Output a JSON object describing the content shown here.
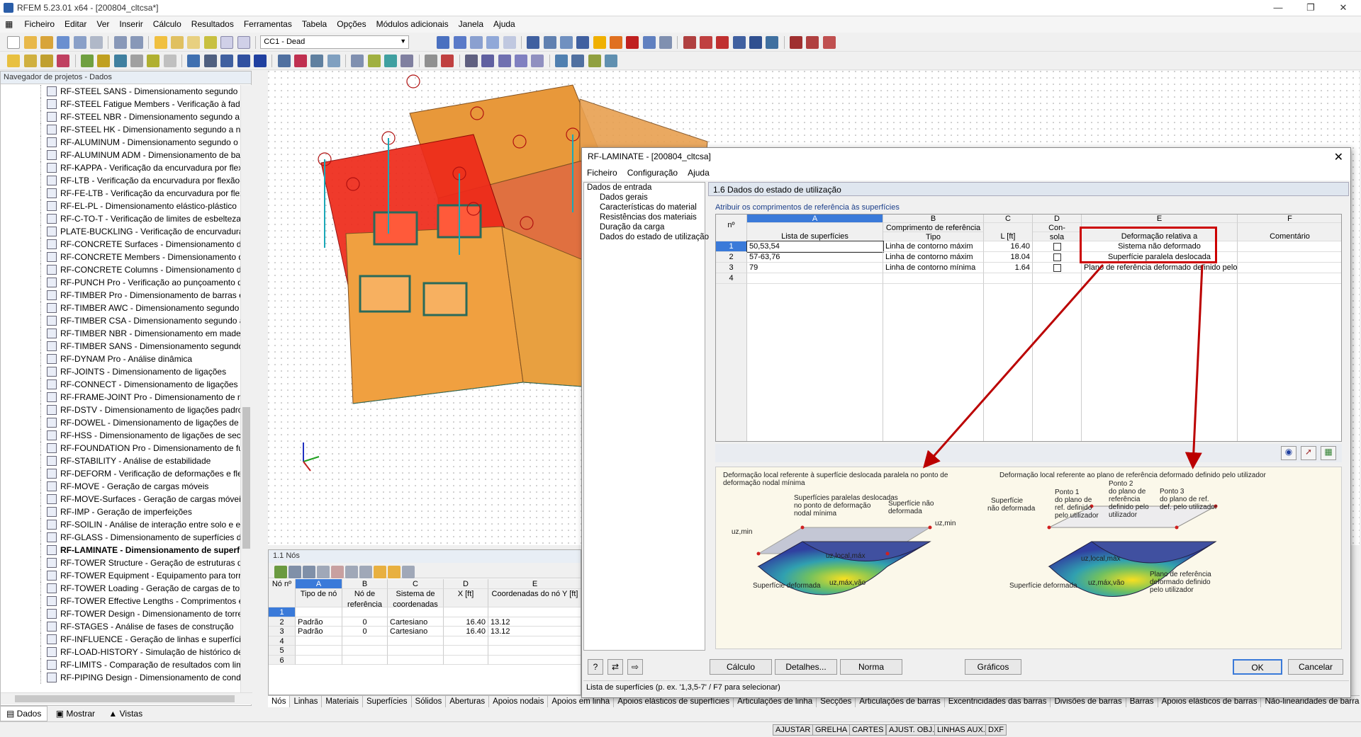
{
  "window": {
    "title": "RFEM 5.23.01 x64 - [200804_cltcsa*]"
  },
  "menu": [
    "Ficheiro",
    "Editar",
    "Ver",
    "Inserir",
    "Cálculo",
    "Resultados",
    "Ferramentas",
    "Tabela",
    "Opções",
    "Módulos adicionais",
    "Janela",
    "Ajuda"
  ],
  "toolbar": {
    "loadcase": "CC1 - Dead"
  },
  "navigator": {
    "title": "Navegador de projetos - Dados",
    "items": [
      {
        "label": "RF-STEEL SANS - Dimensionamento segundo a nor",
        "bold": false
      },
      {
        "label": "RF-STEEL Fatigue Members - Verificação à fadiga",
        "bold": false
      },
      {
        "label": "RF-STEEL NBR - Dimensionamento segundo a NBR",
        "bold": false
      },
      {
        "label": "RF-STEEL HK - Dimensionamento segundo a norm",
        "bold": false
      },
      {
        "label": "RF-ALUMINUM - Dimensionamento segundo o Eu",
        "bold": false
      },
      {
        "label": "RF-ALUMINUM ADM - Dimensionamento de barra",
        "bold": false
      },
      {
        "label": "RF-KAPPA - Verificação da encurvadura por flexão",
        "bold": false
      },
      {
        "label": "RF-LTB - Verificação da encurvadura por flexão-tor",
        "bold": false
      },
      {
        "label": "RF-FE-LTB - Verificação da encurvadura por flexão",
        "bold": false
      },
      {
        "label": "RF-EL-PL - Dimensionamento elástico-plástico",
        "bold": false
      },
      {
        "label": "RF-C-TO-T - Verificação de limites de esbelteza (c/t",
        "bold": false
      },
      {
        "label": "PLATE-BUCKLING - Verificação de encurvadura loc",
        "bold": false
      },
      {
        "label": "RF-CONCRETE Surfaces - Dimensionamento de sup",
        "bold": false
      },
      {
        "label": "RF-CONCRETE Members - Dimensionamento de ba",
        "bold": false
      },
      {
        "label": "RF-CONCRETE Columns - Dimensionamento de pi",
        "bold": false
      },
      {
        "label": "RF-PUNCH Pro - Verificação ao punçoamento de s",
        "bold": false
      },
      {
        "label": "RF-TIMBER Pro - Dimensionamento de barras em r",
        "bold": false
      },
      {
        "label": "RF-TIMBER AWC - Dimensionamento segundo a n",
        "bold": false
      },
      {
        "label": "RF-TIMBER CSA - Dimensionamento segundo a no",
        "bold": false
      },
      {
        "label": "RF-TIMBER NBR - Dimensionamento em madeira s",
        "bold": false
      },
      {
        "label": "RF-TIMBER SANS - Dimensionamento segundo a n",
        "bold": false
      },
      {
        "label": "RF-DYNAM Pro - Análise dinâmica",
        "bold": false
      },
      {
        "label": "RF-JOINTS - Dimensionamento de ligações",
        "bold": false
      },
      {
        "label": "RF-CONNECT - Dimensionamento de ligações de c",
        "bold": false
      },
      {
        "label": "RF-FRAME-JOINT Pro - Dimensionamento de nós c",
        "bold": false
      },
      {
        "label": "RF-DSTV - Dimensionamento de ligações padroniz",
        "bold": false
      },
      {
        "label": "RF-DOWEL - Dimensionamento de ligações de cav",
        "bold": false
      },
      {
        "label": "RF-HSS - Dimensionamento de ligações de secção",
        "bold": false
      },
      {
        "label": "RF-FOUNDATION Pro - Dimensionamento de fund",
        "bold": false
      },
      {
        "label": "RF-STABILITY - Análise de estabilidade",
        "bold": false
      },
      {
        "label": "RF-DEFORM - Verificação de deformações e flecha",
        "bold": false
      },
      {
        "label": "RF-MOVE - Geração de cargas móveis",
        "bold": false
      },
      {
        "label": "RF-MOVE-Surfaces - Geração de cargas móveis em",
        "bold": false
      },
      {
        "label": "RF-IMP - Geração de imperfeições",
        "bold": false
      },
      {
        "label": "RF-SOILIN - Análise de interação entre solo e estrut",
        "bold": false
      },
      {
        "label": "RF-GLASS - Dimensionamento de superfícies de vic",
        "bold": false
      },
      {
        "label": "RF-LAMINATE - Dimensionamento de superfície",
        "bold": true
      },
      {
        "label": "RF-TOWER Structure - Geração de estruturas de tor",
        "bold": false
      },
      {
        "label": "RF-TOWER Equipment - Equipamento para torres t",
        "bold": false
      },
      {
        "label": "RF-TOWER Loading - Geração de cargas de torres t",
        "bold": false
      },
      {
        "label": "RF-TOWER Effective Lengths - Comprimentos efeti",
        "bold": false
      },
      {
        "label": "RF-TOWER Design - Dimensionamento de torres tri",
        "bold": false
      },
      {
        "label": "RF-STAGES - Análise de fases de construção",
        "bold": false
      },
      {
        "label": "RF-INFLUENCE - Geração de linhas e superfícies de",
        "bold": false
      },
      {
        "label": "RF-LOAD-HISTORY - Simulação de histórico de car",
        "bold": false
      },
      {
        "label": "RF-LIMITS - Comparação de resultados com limites",
        "bold": false
      },
      {
        "label": "RF-PIPING Design - Dimensionamento de conduta",
        "bold": false
      }
    ],
    "tabs": [
      "Dados",
      "Mostrar",
      "Vistas"
    ]
  },
  "nodes_panel": {
    "title": "1.1 Nós",
    "cols": [
      "A",
      "B",
      "C",
      "D",
      "E"
    ],
    "headers": [
      "Nó nº",
      "Tipo de nó",
      "Nó de referência",
      "Sistema de coordenadas",
      "X [ft]",
      "Coordenadas do nó Y [ft]"
    ],
    "rows": [
      {
        "n": "1",
        "tipo": "",
        "ref": "",
        "sis": "",
        "x": "",
        "y": ""
      },
      {
        "n": "2",
        "tipo": "Padrão",
        "ref": "0",
        "sis": "Cartesiano",
        "x": "16.40",
        "y": "13.12"
      },
      {
        "n": "3",
        "tipo": "Padrão",
        "ref": "0",
        "sis": "Cartesiano",
        "x": "16.40",
        "y": "13.12"
      },
      {
        "n": "4",
        "tipo": "",
        "ref": "",
        "sis": "",
        "x": "",
        "y": ""
      },
      {
        "n": "5",
        "tipo": "",
        "ref": "",
        "sis": "",
        "x": "",
        "y": ""
      },
      {
        "n": "6",
        "tipo": "",
        "ref": "",
        "sis": "",
        "x": "",
        "y": ""
      }
    ]
  },
  "bottom_tabs": [
    "Nós",
    "Linhas",
    "Materiais",
    "Superfícies",
    "Sólidos",
    "Aberturas",
    "Apoios nodais",
    "Apoios em linha",
    "Apoios elásticos de superfícies",
    "Articulações de linha",
    "Secções",
    "Articulações de barras",
    "Excentricidades das barras",
    "Divisões de barras",
    "Barras",
    "Apoios elásticos de barras",
    "Não-linearidades de barras"
  ],
  "status": [
    "AJUSTAR",
    "GRELHA",
    "CARTES",
    "AJUST. OBJ.",
    "LINHAS AUX.",
    "DXF"
  ],
  "dialog": {
    "title": "RF-LAMINATE - [200804_cltcsa]",
    "menu": [
      "Ficheiro",
      "Configuração",
      "Ajuda"
    ],
    "tree": {
      "root": "Dados de entrada",
      "children": [
        "Dados gerais",
        "Características do material",
        "Resistências dos materiais",
        "Duração da carga",
        "Dados do estado de utilização"
      ]
    },
    "page_title": "1.6 Dados do estado de utilização",
    "subtitle": "Atribuir os comprimentos de referência às superfícies",
    "grid": {
      "cols": [
        "A",
        "B",
        "C",
        "D",
        "E",
        "F"
      ],
      "h_no": "nº",
      "h_a": "Lista de superfícies",
      "h_b1": "Comprimento de referência",
      "h_b2": "Tipo",
      "h_c": "L [ft]",
      "h_d1": "Con-",
      "h_d2": "sola",
      "h_e": "Deformação relativa a",
      "h_f": "Comentário",
      "rows": [
        {
          "n": "1",
          "list": "50,53,54",
          "type": "Linha de contorno máxim",
          "L": "16.40",
          "def": "Sistema não deformado"
        },
        {
          "n": "2",
          "list": "57-63,76",
          "type": "Linha de contorno máxim",
          "L": "18.04",
          "def": "Superfície paralela deslocada"
        },
        {
          "n": "3",
          "list": "79",
          "type": "Linha de contorno mínima",
          "L": "1.64",
          "def": "Plano de referência deformado definido pelo"
        },
        {
          "n": "4",
          "list": "",
          "type": "",
          "L": "",
          "def": ""
        }
      ]
    },
    "illus": {
      "left_title": "Deformação local referente à superfície deslocada paralela no ponto de deformação nodal mínima",
      "left_l1": "Superfícies paralelas deslocadas",
      "left_l2": "no ponto de deformação",
      "left_l3": "nodal mínima",
      "left_l4": "Superfície não",
      "left_l5": "deformada",
      "left_uzmin1": "uz,min",
      "left_uzmin2": "uz,min",
      "left_uzlocal": "uz,local,máx",
      "left_uzvao": "uz,máx,vão",
      "left_def": "Superfície deformada",
      "right_title": "Deformação local referente ao plano de referência deformado definido pelo utilizador",
      "r_sup1": "Superfície",
      "r_sup2": "não deformada",
      "r_p1a": "Ponto 1",
      "r_p1b": "do plano de",
      "r_p1c": "ref. definido",
      "r_p1d": "pelo utilizador",
      "r_p2a": "Ponto 2",
      "r_p2b": "do plano de",
      "r_p2c": "referência",
      "r_p2d": "definido pelo",
      "r_p2e": "utilizador",
      "r_p3a": "Ponto 3",
      "r_p3b": "do plano de ref.",
      "r_p3c": "def. pelo utilizador",
      "r_pl1": "Plano de referência",
      "r_pl2": "deformado definido",
      "r_pl3": "pelo utilizador",
      "r_uzlocal": "uz,local,máx",
      "r_uzvao": "uz,máx,vão",
      "r_def": "Superfície deformada"
    },
    "buttons": {
      "calc": "Cálculo",
      "details": "Detalhes...",
      "norm": "Norma",
      "graphics": "Gráficos",
      "ok": "OK",
      "cancel": "Cancelar"
    },
    "status": "Lista de superfícies (p. ex. '1,3,5-7' / F7 para selecionar)",
    "colors": {
      "highlight": "#cc0000",
      "accent": "#3a7ad9"
    }
  }
}
